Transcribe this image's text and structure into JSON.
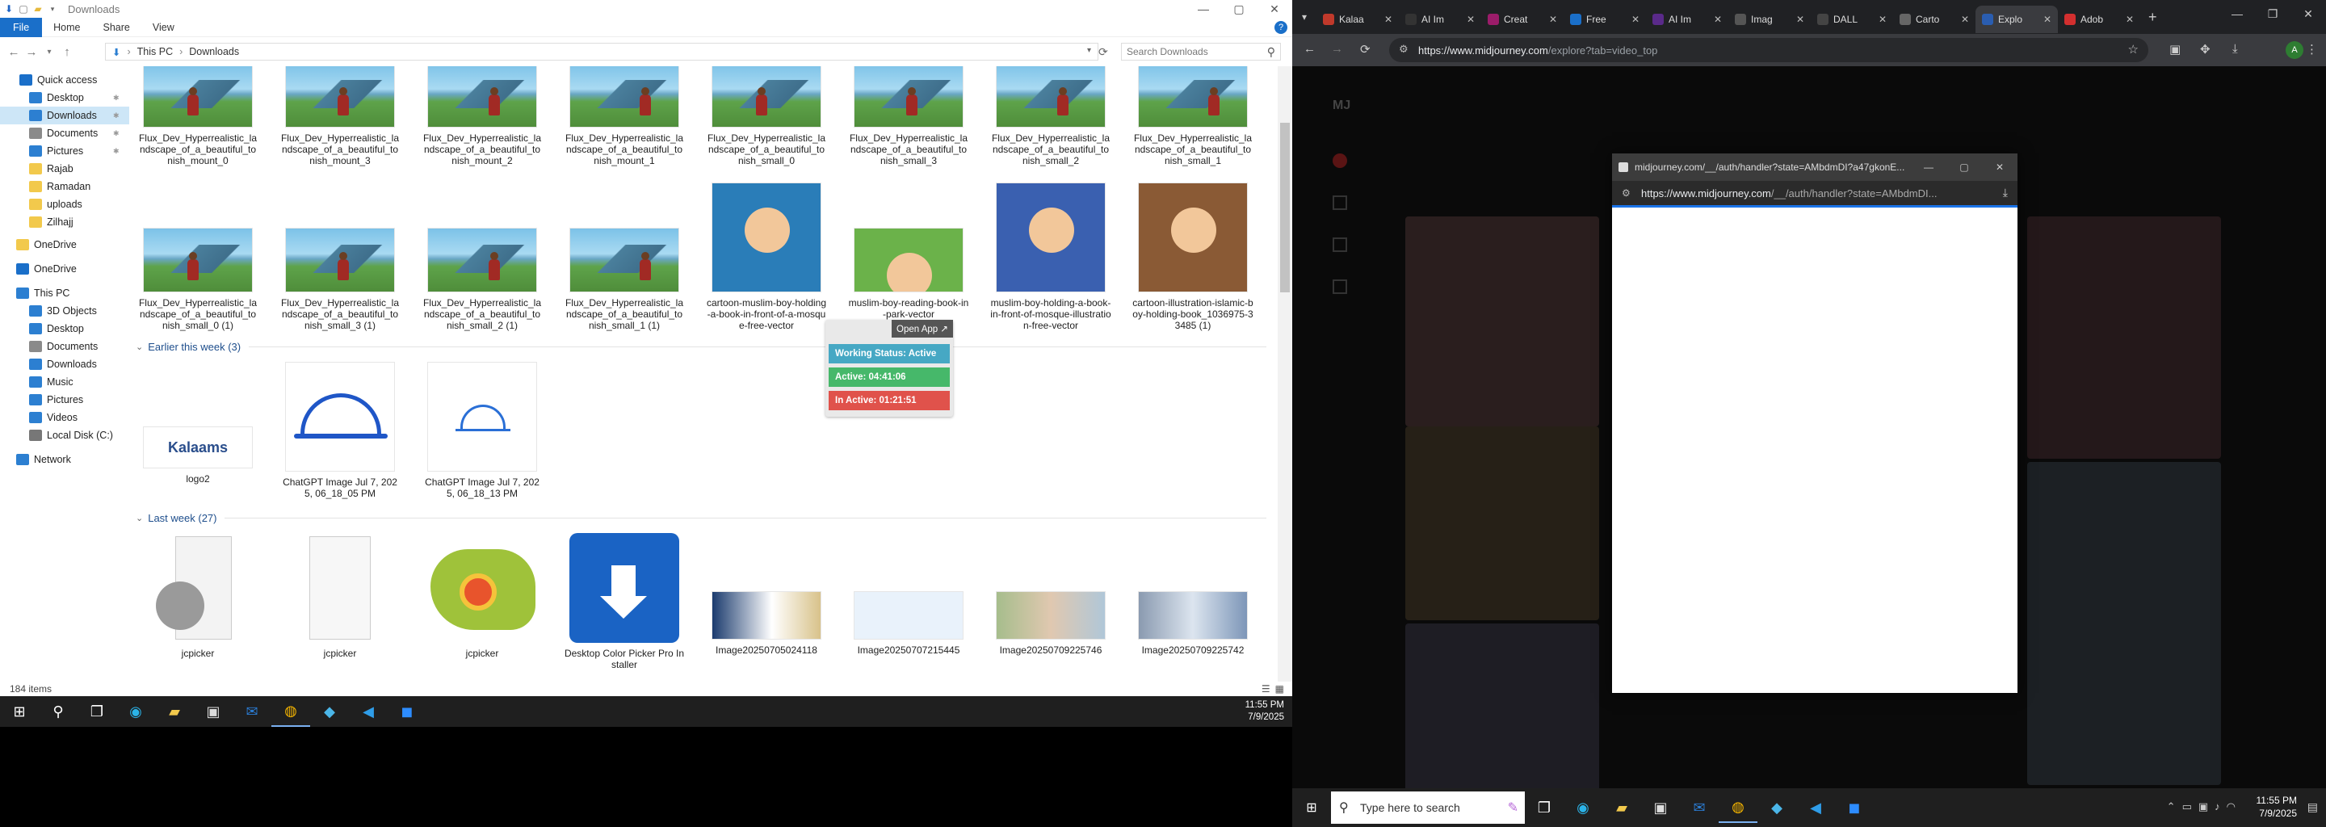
{
  "explorer": {
    "title": "Downloads",
    "ribbon_tabs": [
      "File",
      "Home",
      "Share",
      "View"
    ],
    "breadcrumb": [
      "This PC",
      "Downloads"
    ],
    "search_placeholder": "Search Downloads",
    "nav": [
      {
        "label": "Quick access",
        "icon": "star-icon",
        "color": "#1a6fc9"
      },
      {
        "label": "Desktop",
        "icon": "desktop-icon",
        "color": "#2c7fd1",
        "pinned": true
      },
      {
        "label": "Downloads",
        "icon": "download-icon",
        "color": "#2c7fd1",
        "pinned": true,
        "selected": true
      },
      {
        "label": "Documents",
        "icon": "documents-icon",
        "color": "#8a8a8a",
        "pinned": true
      },
      {
        "label": "Pictures",
        "icon": "pictures-icon",
        "color": "#2c7fd1",
        "pinned": true
      },
      {
        "label": "Rajab",
        "icon": "folder-icon",
        "color": "#f2c94c"
      },
      {
        "label": "Ramadan",
        "icon": "folder-icon",
        "color": "#f2c94c"
      },
      {
        "label": "uploads",
        "icon": "folder-icon",
        "color": "#f2c94c"
      },
      {
        "label": "Zilhajj",
        "icon": "folder-icon",
        "color": "#f2c94c"
      },
      {
        "label": "OneDrive",
        "icon": "folder-icon",
        "color": "#f2c94c"
      },
      {
        "label": "OneDrive",
        "icon": "cloud-icon",
        "color": "#1a6fc9"
      },
      {
        "label": "This PC",
        "icon": "computer-icon",
        "color": "#2c7fd1"
      },
      {
        "label": "3D Objects",
        "icon": "cube-icon",
        "color": "#2c7fd1"
      },
      {
        "label": "Desktop",
        "icon": "desktop-icon",
        "color": "#2c7fd1"
      },
      {
        "label": "Documents",
        "icon": "documents-icon",
        "color": "#8a8a8a"
      },
      {
        "label": "Downloads",
        "icon": "download-icon",
        "color": "#2c7fd1"
      },
      {
        "label": "Music",
        "icon": "music-icon",
        "color": "#2c7fd1"
      },
      {
        "label": "Pictures",
        "icon": "pictures-icon",
        "color": "#2c7fd1"
      },
      {
        "label": "Videos",
        "icon": "videos-icon",
        "color": "#2c7fd1"
      },
      {
        "label": "Local Disk (C:)",
        "icon": "disk-icon",
        "color": "#777777"
      },
      {
        "label": "Network",
        "icon": "network-icon",
        "color": "#2c7fd1"
      }
    ],
    "row1": [
      "Flux_Dev_Hyperrealistic_landscape_of_a_beautiful_tonish_mount_0",
      "Flux_Dev_Hyperrealistic_landscape_of_a_beautiful_tonish_mount_3",
      "Flux_Dev_Hyperrealistic_landscape_of_a_beautiful_tonish_mount_2",
      "Flux_Dev_Hyperrealistic_landscape_of_a_beautiful_tonish_mount_1",
      "Flux_Dev_Hyperrealistic_landscape_of_a_beautiful_tonish_small_0",
      "Flux_Dev_Hyperrealistic_landscape_of_a_beautiful_tonish_small_3",
      "Flux_Dev_Hyperrealistic_landscape_of_a_beautiful_tonish_small_2",
      "Flux_Dev_Hyperrealistic_landscape_of_a_beautiful_tonish_small_1"
    ],
    "row2": [
      "Flux_Dev_Hyperrealistic_landscape_of_a_beautiful_tonish_small_0 (1)",
      "Flux_Dev_Hyperrealistic_landscape_of_a_beautiful_tonish_small_3 (1)",
      "Flux_Dev_Hyperrealistic_landscape_of_a_beautiful_tonish_small_2 (1)",
      "Flux_Dev_Hyperrealistic_landscape_of_a_beautiful_tonish_small_1 (1)",
      "cartoon-muslim-boy-holding-a-book-in-front-of-a-mosque-free-vector",
      "muslim-boy-reading-book-in-park-vector",
      "muslim-boy-holding-a-book-in-front-of-mosque-illustration-free-vector",
      "cartoon-illustration-islamic-boy-holding-book_1036975-33485 (1)"
    ],
    "group_earlier": "Earlier this week (3)",
    "row3": [
      "logo2",
      "ChatGPT Image Jul 7, 2025, 06_18_05 PM",
      "ChatGPT Image Jul 7, 2025, 06_18_13 PM"
    ],
    "logo_text": "Kalaams",
    "group_last": "Last week (27)",
    "row4": [
      "jcpicker",
      "jcpicker",
      "jcpicker",
      "Desktop Color Picker Pro Installer",
      "Image20250705024118",
      "Image20250707215445",
      "Image20250709225746",
      "Image20250709225742"
    ],
    "status": "184 items",
    "widget": {
      "open_app": "Open App ↗",
      "working": "Working Status: Active",
      "active": "Active: 04:41:06",
      "inactive": "In Active: 01:21:51"
    }
  },
  "taskbar_left": {
    "time": "11:55 PM",
    "date": "7/9/2025"
  },
  "chrome": {
    "tabs": [
      {
        "label": "Kalaa",
        "color": "#c0392b"
      },
      {
        "label": "AI Im",
        "color": "#333333"
      },
      {
        "label": "Creat",
        "color": "#9b1c6a"
      },
      {
        "label": "Free",
        "color": "#1a6fc9"
      },
      {
        "label": "AI Im",
        "color": "#5a2a8a"
      },
      {
        "label": "Imag",
        "color": "#555555"
      },
      {
        "label": "DALL",
        "color": "#444444"
      },
      {
        "label": "Carto",
        "color": "#666666"
      },
      {
        "label": "Explo",
        "color": "#2a5db0",
        "active": true
      },
      {
        "label": "Adob",
        "color": "#d32f2f"
      }
    ],
    "url_host": "https://www.midjourney.com",
    "url_path": "/explore?tab=video_top",
    "profile_initial": "A",
    "popup": {
      "title": "midjourney.com/__/auth/handler?state=AMbdmDI?a47gkonE...",
      "url_host": "https://www.midjourney.com",
      "url_path": "/__/auth/handler?state=AMbdmDI..."
    },
    "search_text": "Type here to search",
    "time": "11:55 PM",
    "date": "7/9/2025"
  }
}
